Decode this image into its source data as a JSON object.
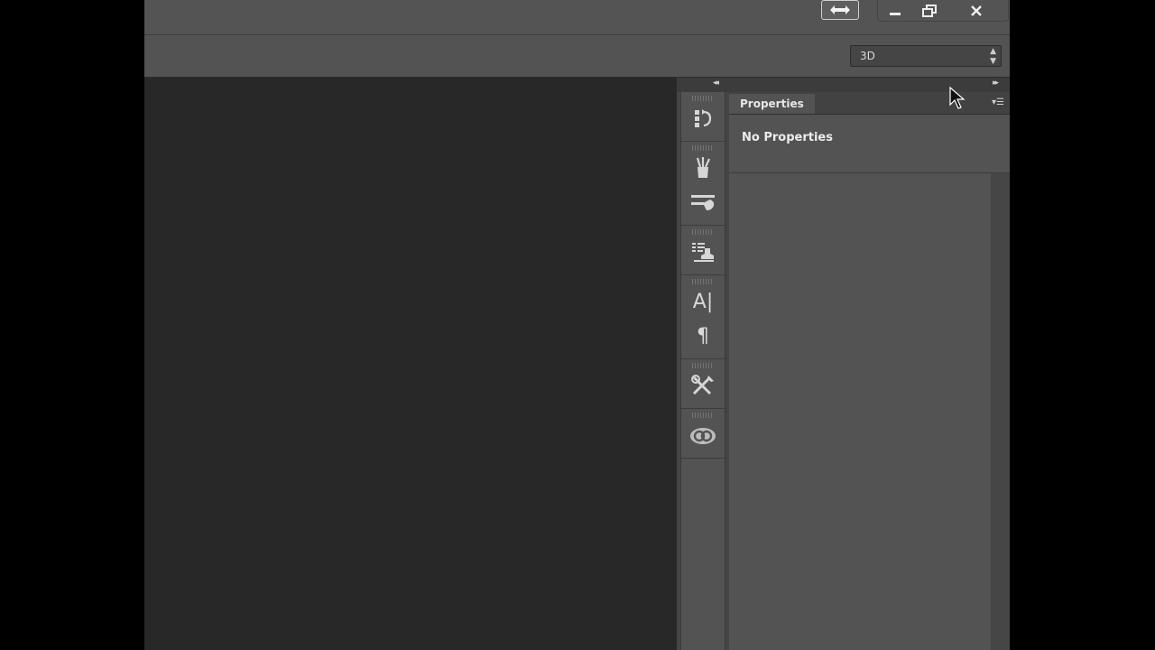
{
  "titlebar": {
    "arrange_icon": "arrange-documents-icon",
    "minimize_icon": "minimize-icon",
    "restore_icon": "restore-icon",
    "close_icon": "close-icon"
  },
  "options_bar": {
    "workspace_value": "3D"
  },
  "dock": {
    "collapse_left_label": "◂◂",
    "collapse_right_label": "▸▸",
    "icon_groups": [
      [
        "history-icon"
      ],
      [
        "brushes-icon",
        "brush-presets-icon"
      ],
      [
        "clone-source-icon"
      ],
      [
        "character-icon",
        "paragraph-icon"
      ],
      [
        "tool-presets-icon"
      ],
      [
        "creative-cloud-icon"
      ]
    ],
    "character_glyph": "A|",
    "paragraph_glyph": "¶"
  },
  "properties_panel": {
    "tab_label": "Properties",
    "empty_message": "No Properties",
    "menu_icon": "panel-menu-icon"
  },
  "colors": {
    "canvas_bg": "#282828",
    "panel_bg": "#535353",
    "dock_bg": "#454545"
  }
}
